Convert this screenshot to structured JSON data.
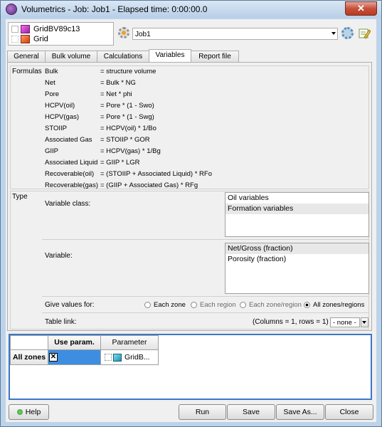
{
  "window": {
    "title": "Volumetrics - Job: Job1 - Elapsed time: 0:00:00.0",
    "close_label": "✕"
  },
  "selector": {
    "items": [
      {
        "label": "GridBV89c13",
        "icon": "grid-purple-icon"
      },
      {
        "label": "Grid",
        "icon": "grid-orange-icon"
      }
    ]
  },
  "job": {
    "value": "Job1"
  },
  "tabs": [
    {
      "label": "General",
      "active": false
    },
    {
      "label": "Bulk volume",
      "active": false
    },
    {
      "label": "Calculations",
      "active": false
    },
    {
      "label": "Variables",
      "active": true
    },
    {
      "label": "Report file",
      "active": false
    }
  ],
  "formulas": {
    "label": "Formulas",
    "rows": [
      {
        "name": "Bulk",
        "expr": "= structure volume"
      },
      {
        "name": "Net",
        "expr": "= Bulk * NG"
      },
      {
        "name": "Pore",
        "expr": "= Net * phi"
      },
      {
        "name": "HCPV(oil)",
        "expr": "= Pore * (1 - Swo)"
      },
      {
        "name": "HCPV(gas)",
        "expr": "= Pore * (1 - Swg)"
      },
      {
        "name": "STOIIP",
        "expr": "= HCPV(oil) * 1/Bo"
      },
      {
        "name": "Associated Gas",
        "expr": "= STOIIP * GOR"
      },
      {
        "name": "GIIP",
        "expr": "= HCPV(gas) * 1/Bg"
      },
      {
        "name": "Associated Liquid",
        "expr": "= GIIP * LGR"
      },
      {
        "name": "Recoverable(oil)",
        "expr": "= (STOIIP + Associated Liquid) * RFo"
      },
      {
        "name": "Recoverable(gas)",
        "expr": "= (GIIP + Associated Gas) * RFg"
      }
    ]
  },
  "type": {
    "label": "Type",
    "variable_class_label": "Variable class:",
    "variable_class_items": [
      "Oil variables",
      "Formation variables"
    ],
    "variable_label": "Variable:",
    "variable_items": [
      "Net/Gross (fraction)",
      "Porosity (fraction)"
    ],
    "give_values_label": "Give values for:",
    "radio_options": [
      {
        "label": "Each zone",
        "checked": false,
        "enabled": true
      },
      {
        "label": "Each region",
        "checked": false,
        "enabled": false
      },
      {
        "label": "Each zone/region",
        "checked": false,
        "enabled": false
      },
      {
        "label": "All zones/regions",
        "checked": true,
        "enabled": true
      }
    ],
    "table_link_label": "Table link:",
    "table_link_info": "(Columns = 1, rows = 1)",
    "table_link_value": "- none -"
  },
  "grid": {
    "col_use_param": "Use param.",
    "col_parameter": "Parameter",
    "row_label": "All zones",
    "checkbox_mark": "✕",
    "param_value": "GridB..."
  },
  "buttons": {
    "help": "Help",
    "run": "Run",
    "save": "Save",
    "save_as": "Save As...",
    "close": "Close"
  }
}
